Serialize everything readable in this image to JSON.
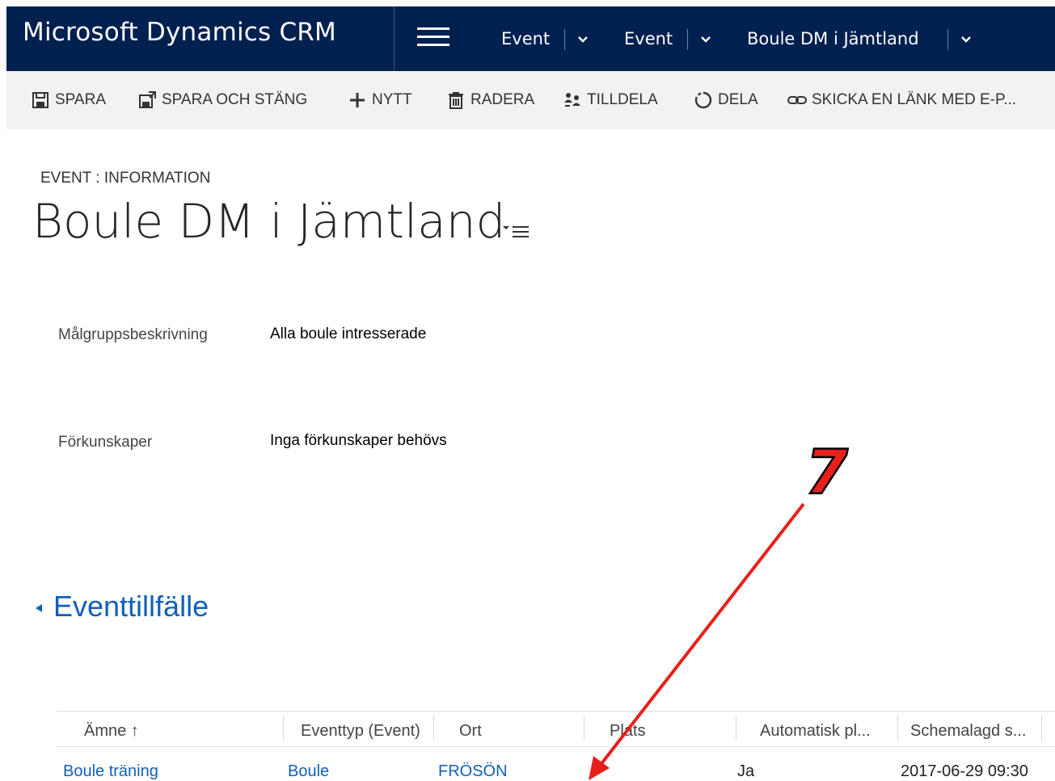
{
  "navbar": {
    "app_title": "Microsoft Dynamics CRM",
    "breadcrumbs": [
      {
        "label": "Event"
      },
      {
        "label": "Event"
      },
      {
        "label": "Boule DM i Jämtland"
      }
    ]
  },
  "commands": [
    {
      "label": "SPARA",
      "icon": "save-icon"
    },
    {
      "label": "SPARA OCH STÄNG",
      "icon": "save-close-icon"
    },
    {
      "label": "NYTT",
      "icon": "plus-icon"
    },
    {
      "label": "RADERA",
      "icon": "trash-icon"
    },
    {
      "label": "TILLDELA",
      "icon": "assign-icon"
    },
    {
      "label": "DELA",
      "icon": "share-icon"
    },
    {
      "label": "SKICKA EN LÄNK MED E-P...",
      "icon": "link-icon"
    }
  ],
  "header": {
    "form_type": "EVENT : INFORMATION",
    "title": "Boule DM i Jämtland"
  },
  "fields": [
    {
      "label": "Målgruppsbeskrivning",
      "value": "Alla boule intresserade"
    },
    {
      "label": "Förkunskaper",
      "value": "Inga förkunskaper behövs"
    }
  ],
  "section": {
    "title": "Eventtillfälle"
  },
  "grid": {
    "columns": [
      "Ämne ↑",
      "Eventtyp (Event)",
      "Ort",
      "Plats",
      "Automatisk pl...",
      "Schemalagd s..."
    ],
    "rows": [
      {
        "amne": "Boule träning",
        "eventtyp": "Boule",
        "ort": "FRÖSÖN",
        "plats": "",
        "automatisk": "Ja",
        "schemalagd": "2017-06-29 09:30"
      }
    ]
  },
  "annotation": {
    "number": "7",
    "color": "#e8201a"
  },
  "colors": {
    "navbar": "#002050",
    "link": "#1160b7",
    "cmdbar": "#f2f2f2"
  }
}
